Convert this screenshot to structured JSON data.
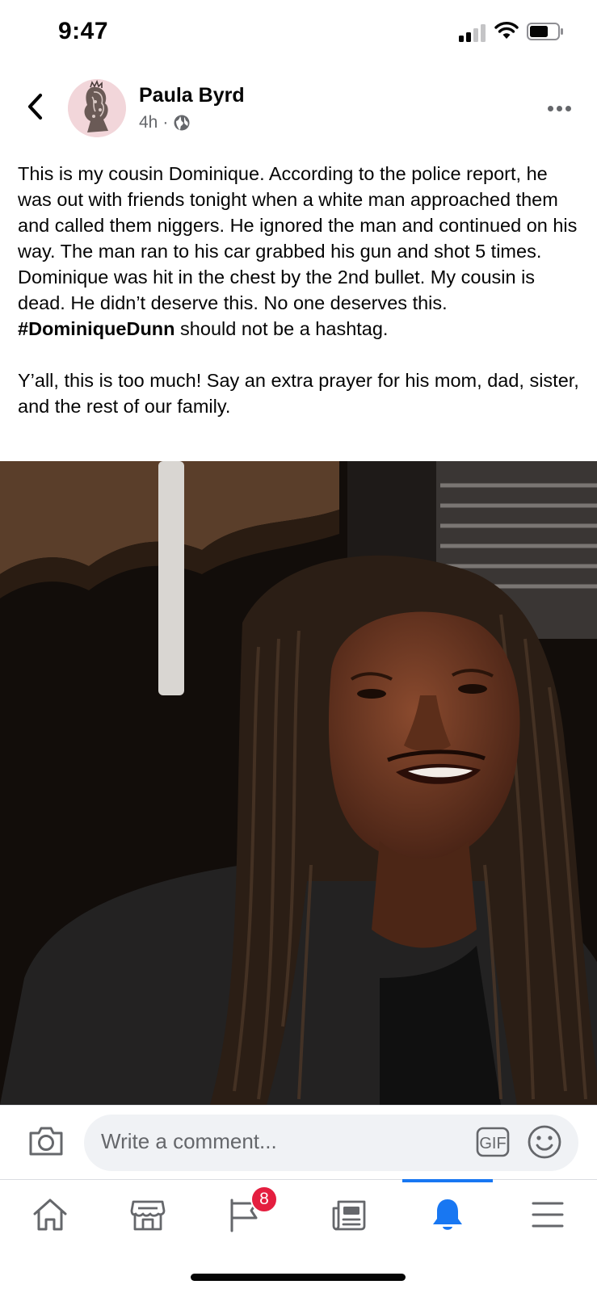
{
  "status_bar": {
    "time": "9:47"
  },
  "post": {
    "author": "Paula Byrd",
    "time_ago": "4h",
    "separator": "·",
    "paragraph1_before_hashtag": "This is my cousin Dominique. According to the police report, he was out with friends tonight when a white man approached them and called them niggers. He ignored the man and continued on his way. The man ran to his car grabbed his gun and shot 5 times. Dominique was hit in the chest by the 2nd bullet. My cousin is dead. He didn’t deserve this. No one deserves this. ",
    "hashtag": "#DominiqueDunn",
    "paragraph1_after_hashtag": " should not be a hashtag.",
    "paragraph2": "Y’all, this is too much! Say an extra prayer for his mom, dad, sister, and the rest of our family."
  },
  "comment_bar": {
    "placeholder": "Write a comment...",
    "gif_label": "GIF"
  },
  "tab_bar": {
    "notifications_badge": "8",
    "active_tab": "notifications",
    "accent_color": "#1877f2",
    "badge_color": "#e41e3f"
  },
  "icons": [
    "back-arrow-icon",
    "globe-icon",
    "more-icon",
    "camera-icon",
    "gif-icon",
    "emoji-icon",
    "home-icon",
    "marketplace-icon",
    "flag-icon",
    "news-icon",
    "bell-icon",
    "menu-icon"
  ]
}
